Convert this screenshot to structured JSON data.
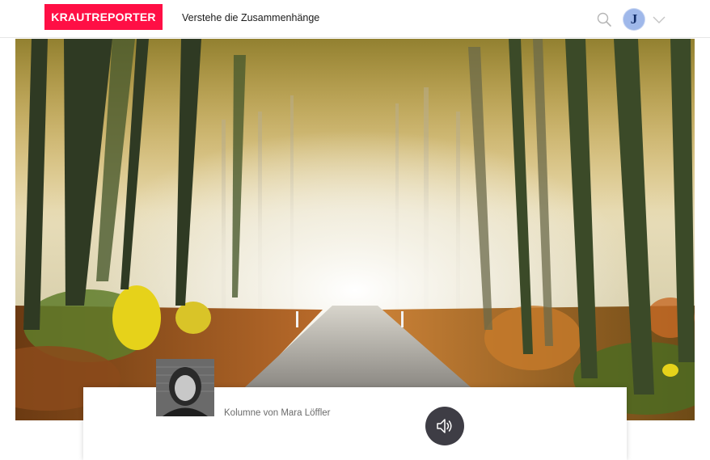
{
  "header": {
    "logo_text": "KRAUTREPORTER",
    "tagline": "Verstehe die Zusammenhänge",
    "search_icon": "search-icon",
    "avatar_initial": "J",
    "menu_icon": "chevron-down-icon"
  },
  "colors": {
    "brand": "#ff0f45",
    "audio_button": "#3e3d45",
    "avatar_bg": "#9fb8ea"
  },
  "article": {
    "byline": "Kolumne von Mara Löffler",
    "audio_icon": "speaker-icon"
  }
}
